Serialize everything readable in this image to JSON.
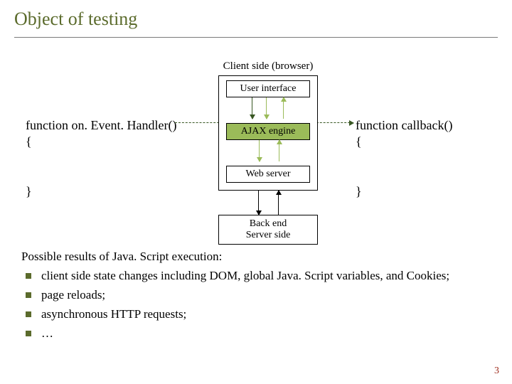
{
  "title": "Object of testing",
  "diagram": {
    "client_label": "Client side (browser)",
    "ui": "User interface",
    "ajax": "AJAX engine",
    "web": "Web server",
    "backend_line1": "Back end",
    "backend_line2": "Server side"
  },
  "code_left": {
    "sig": "function on. Event. Handler()",
    "open": "{",
    "close": "}"
  },
  "code_right": {
    "sig": "function callback()",
    "open": "{",
    "close": "}"
  },
  "results": {
    "intro": "Possible results of Java. Script execution:",
    "items": [
      "client side state changes including DOM, global Java. Script variables, and Cookies;",
      "page reloads;",
      "asynchronous HTTP requests;",
      "…"
    ]
  },
  "page_number": "3"
}
